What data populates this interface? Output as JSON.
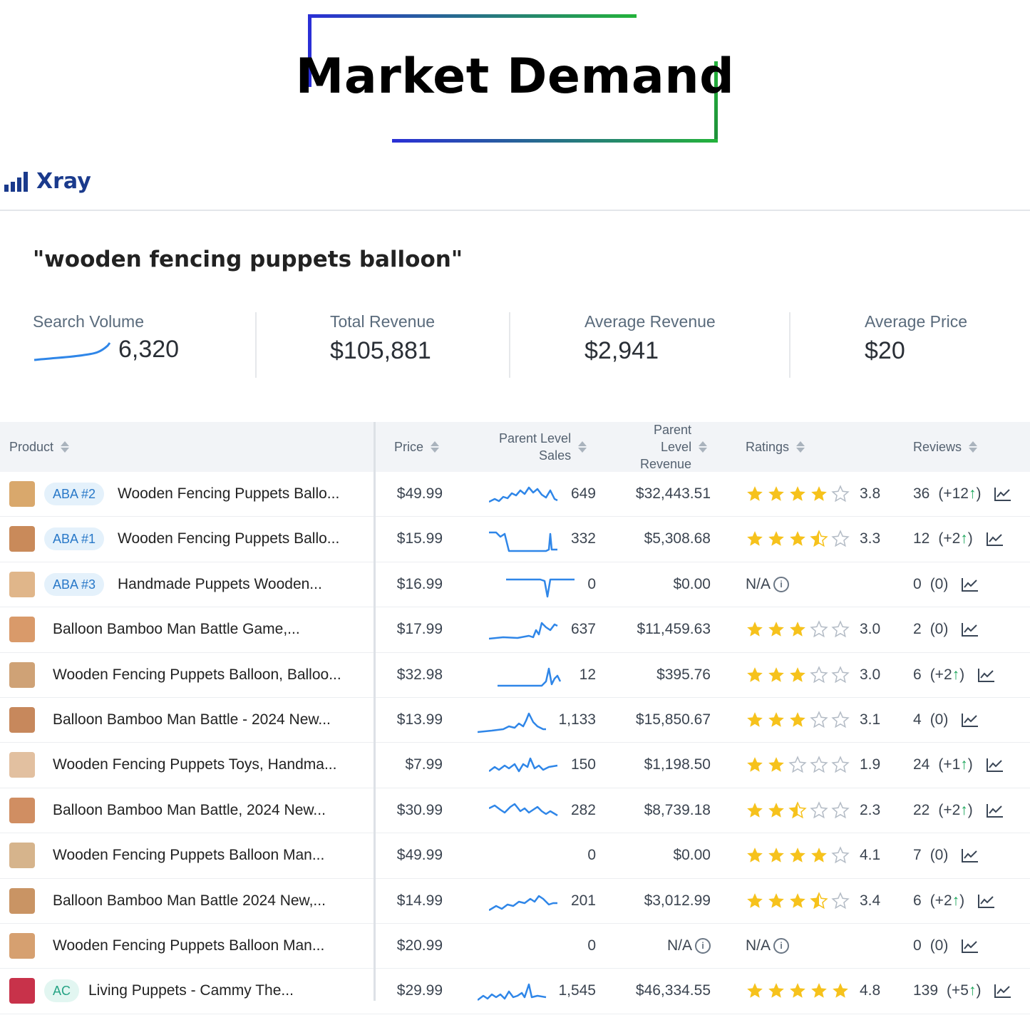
{
  "banner": {
    "title": "Market Demand"
  },
  "app": {
    "name": "Xray"
  },
  "query": "\"wooden fencing puppets balloon\"",
  "metrics": {
    "search_volume": {
      "label": "Search Volume",
      "value": "6,320"
    },
    "total_revenue": {
      "label": "Total Revenue",
      "value": "$105,881"
    },
    "average_revenue": {
      "label": "Average Revenue",
      "value": "$2,941"
    },
    "average_price": {
      "label": "Average Price",
      "value": "$20"
    }
  },
  "table": {
    "headers": {
      "product": "Product",
      "price": "Price",
      "sales": [
        "Parent Level",
        "Sales"
      ],
      "revenue": [
        "Parent",
        "Level",
        "Revenue"
      ],
      "ratings": "Ratings",
      "reviews": "Reviews"
    },
    "rows": [
      {
        "badge": "ABA #2",
        "name": "Wooden Fencing Puppets Ballo...",
        "price": "$49.99",
        "sales": "649",
        "revenue": "$32,443.51",
        "rating": 3.8,
        "rating_text": "3.8",
        "reviews": "36",
        "reviews_delta": "(+12",
        "reviews_up": true,
        "spark": "s1"
      },
      {
        "badge": "ABA #1",
        "name": "Wooden Fencing Puppets Ballo...",
        "price": "$15.99",
        "sales": "332",
        "revenue": "$5,308.68",
        "rating": 3.3,
        "rating_text": "3.3",
        "reviews": "12",
        "reviews_delta": "(+2",
        "reviews_up": true,
        "spark": "s2"
      },
      {
        "badge": "ABA #3",
        "name": "Handmade Puppets Wooden...",
        "price": "$16.99",
        "sales": "0",
        "revenue": "$0.00",
        "rating": null,
        "rating_text": "N/A",
        "reviews": "0",
        "reviews_delta": "(0)",
        "reviews_up": false,
        "spark": "s3"
      },
      {
        "badge": "",
        "name": "Balloon Bamboo Man Battle Game,...",
        "price": "$17.99",
        "sales": "637",
        "revenue": "$11,459.63",
        "rating": 3.0,
        "rating_text": "3.0",
        "reviews": "2",
        "reviews_delta": "(0)",
        "reviews_up": false,
        "spark": "s4"
      },
      {
        "badge": "",
        "name": "Wooden Fencing Puppets Balloon, Balloo...",
        "price": "$32.98",
        "sales": "12",
        "revenue": "$395.76",
        "rating": 3.0,
        "rating_text": "3.0",
        "reviews": "6",
        "reviews_delta": "(+2",
        "reviews_up": true,
        "spark": "s5"
      },
      {
        "badge": "",
        "name": "Balloon Bamboo Man Battle - 2024 New...",
        "price": "$13.99",
        "sales": "1,133",
        "revenue": "$15,850.67",
        "rating": 3.1,
        "rating_text": "3.1",
        "reviews": "4",
        "reviews_delta": "(0)",
        "reviews_up": false,
        "spark": "s6"
      },
      {
        "badge": "",
        "name": "Wooden Fencing Puppets Toys, Handma...",
        "price": "$7.99",
        "sales": "150",
        "revenue": "$1,198.50",
        "rating": 1.9,
        "rating_text": "1.9",
        "reviews": "24",
        "reviews_delta": "(+1",
        "reviews_up": true,
        "spark": "s7"
      },
      {
        "badge": "",
        "name": "Balloon Bamboo Man Battle, 2024 New...",
        "price": "$30.99",
        "sales": "282",
        "revenue": "$8,739.18",
        "rating": 2.3,
        "rating_text": "2.3",
        "reviews": "22",
        "reviews_delta": "(+2",
        "reviews_up": true,
        "spark": "s8"
      },
      {
        "badge": "",
        "name": "Wooden Fencing Puppets Balloon Man...",
        "price": "$49.99",
        "sales": "0",
        "revenue": "$0.00",
        "rating": 4.1,
        "rating_text": "4.1",
        "reviews": "7",
        "reviews_delta": "(0)",
        "reviews_up": false,
        "spark": ""
      },
      {
        "badge": "",
        "name": "Balloon Bamboo Man Battle 2024 New,...",
        "price": "$14.99",
        "sales": "201",
        "revenue": "$3,012.99",
        "rating": 3.4,
        "rating_text": "3.4",
        "reviews": "6",
        "reviews_delta": "(+2",
        "reviews_up": true,
        "spark": "s10"
      },
      {
        "badge": "",
        "name": "Wooden Fencing Puppets Balloon Man...",
        "price": "$20.99",
        "sales": "0",
        "revenue": "N/A",
        "rating": null,
        "rating_text": "N/A",
        "reviews": "0",
        "reviews_delta": "(0)",
        "reviews_up": false,
        "spark": ""
      },
      {
        "badge": "AC",
        "name": "Living Puppets - Cammy The...",
        "price": "$29.99",
        "sales": "1,545",
        "revenue": "$46,334.55",
        "rating": 4.8,
        "rating_text": "4.8",
        "reviews": "139",
        "reviews_delta": "(+5",
        "reviews_up": true,
        "spark": "s12"
      }
    ]
  },
  "colors": {
    "accent": "#1a3a8c",
    "spark": "#2f86e8",
    "star": "#f6c21c",
    "star_empty": "#b4bcc6",
    "up": "#1aa55a",
    "badge_bg": "#e4f1fb",
    "badge_text": "#2878c8",
    "ac_bg": "#e2f6f1",
    "ac_text": "#25a384"
  },
  "icons": {
    "sort": "sort-arrows-icon",
    "trend": "trend-chart-icon",
    "info": "info-icon",
    "star": "star-icon"
  }
}
